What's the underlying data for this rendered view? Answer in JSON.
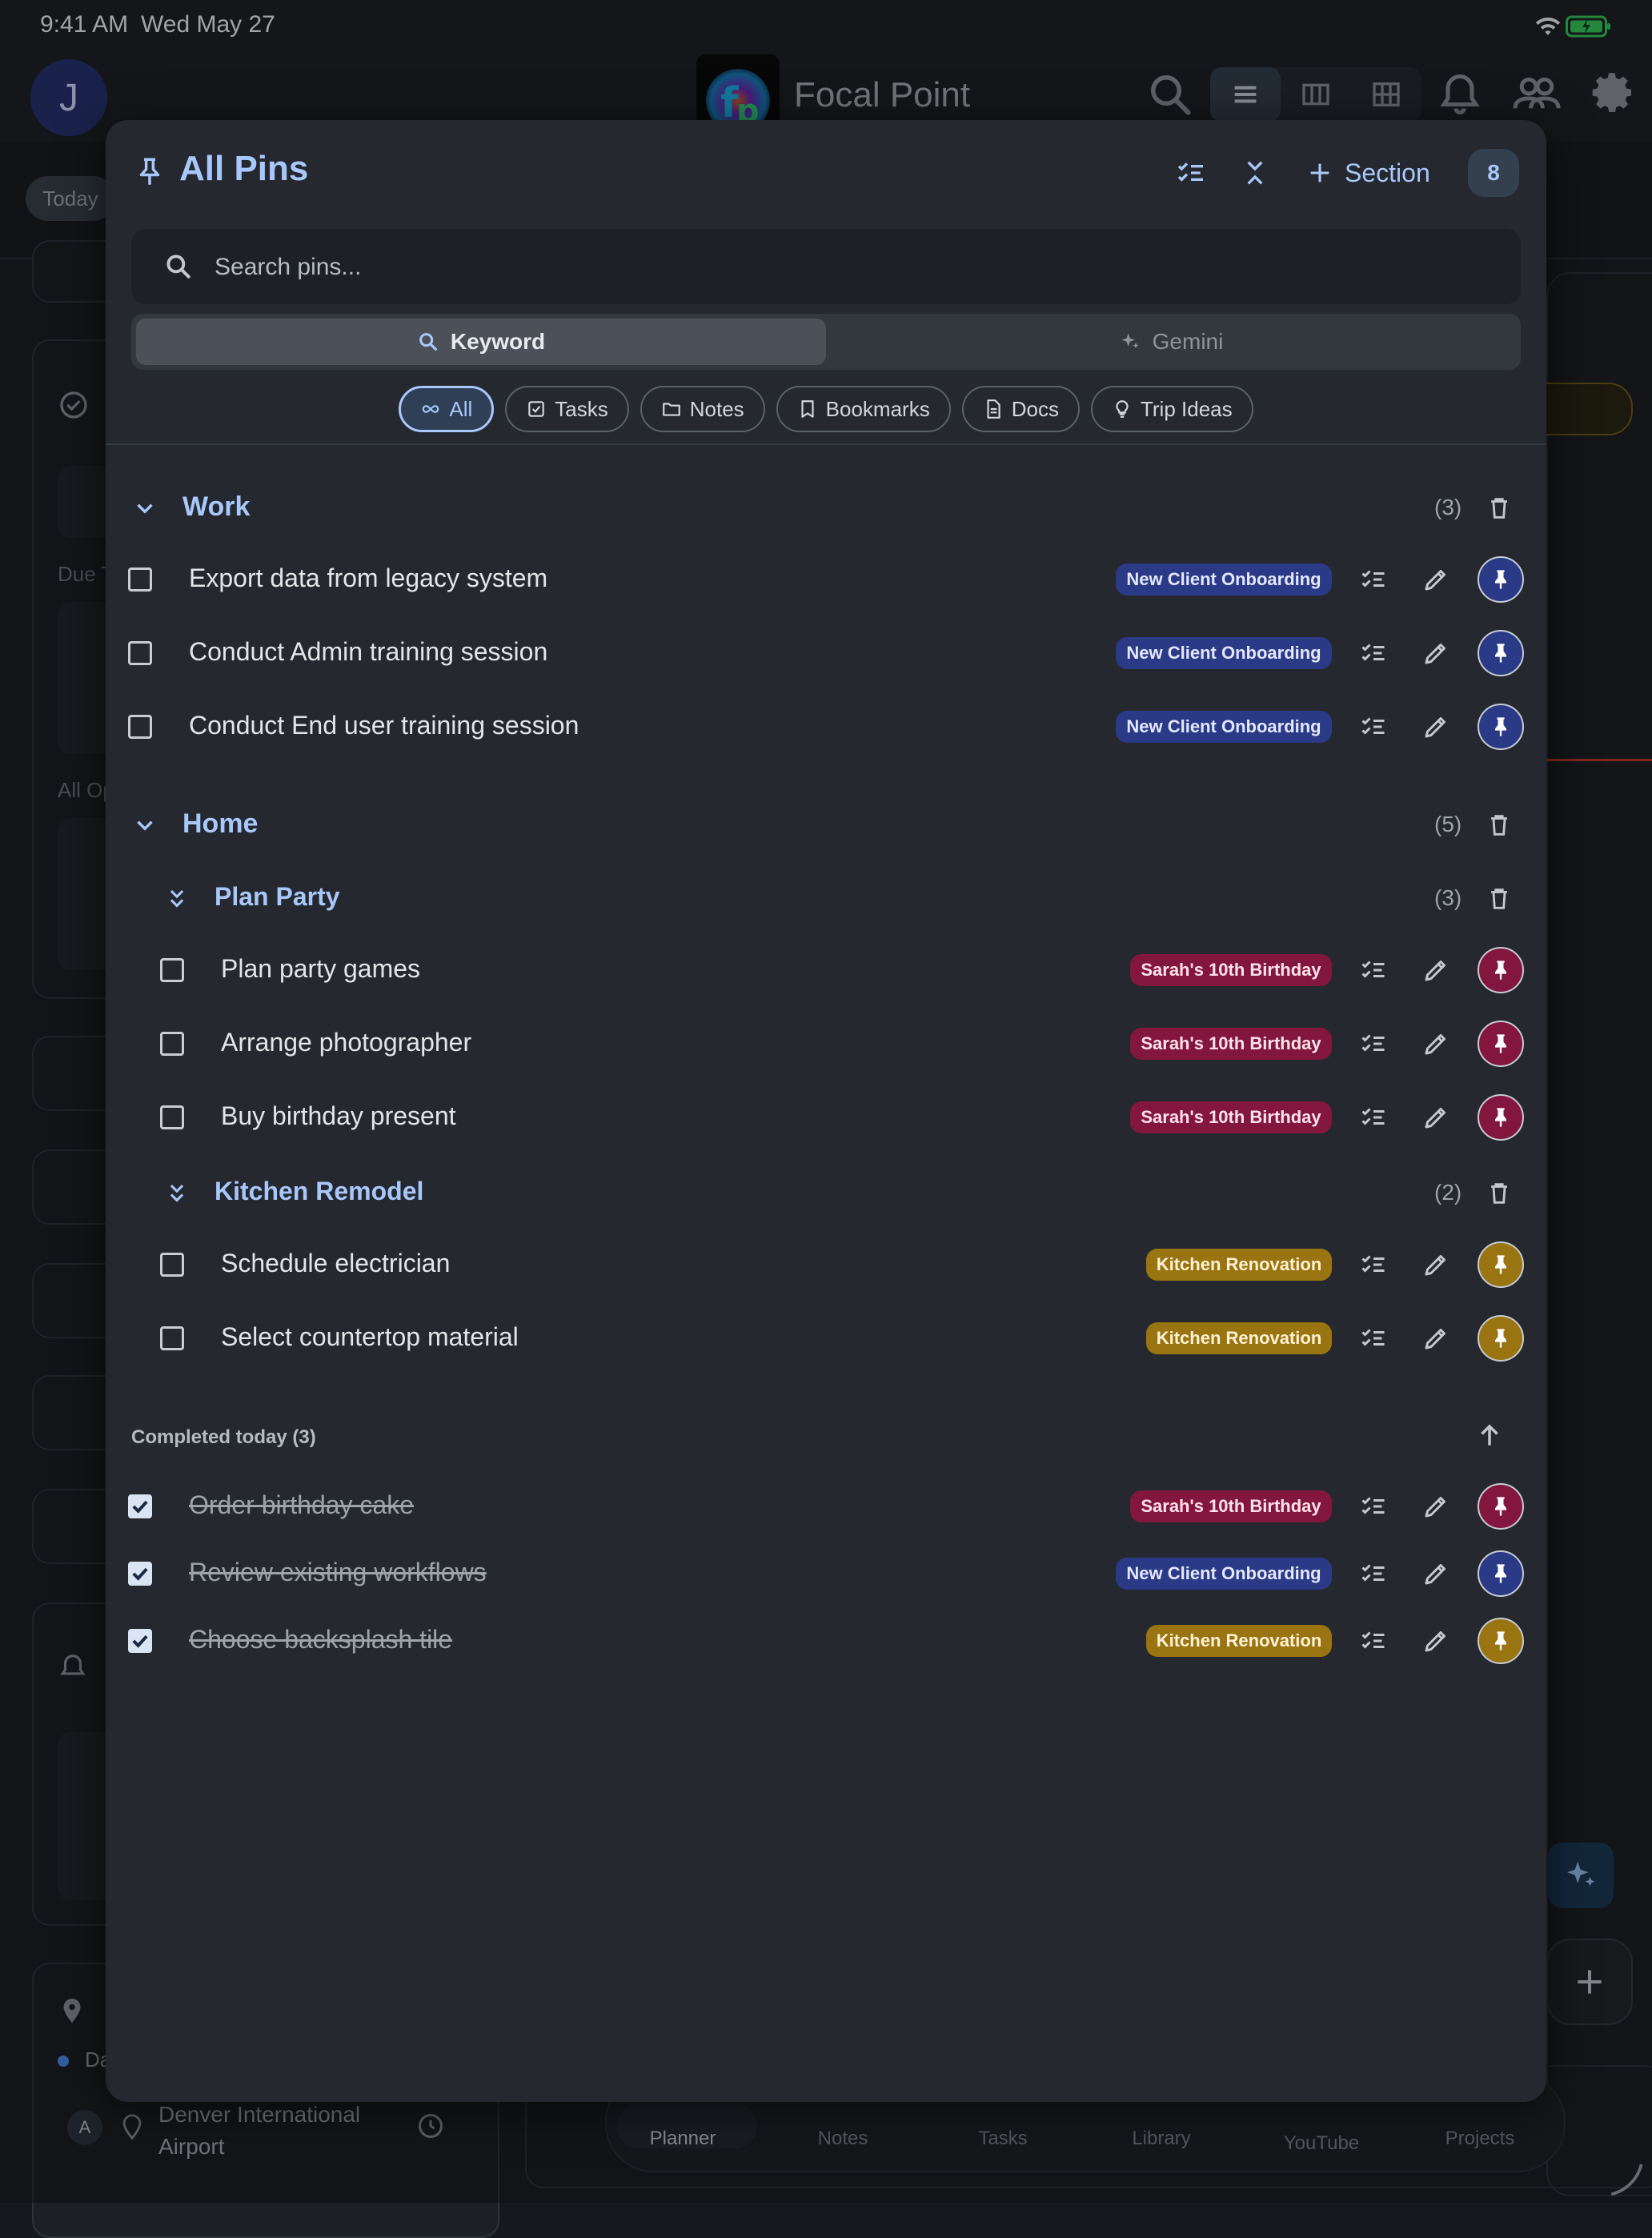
{
  "status_bar": {
    "time": "9:41 AM",
    "date": "Wed May 27"
  },
  "app_header": {
    "avatar_initial": "J",
    "app_title": "Focal Point",
    "today_chip": "Today",
    "icons": [
      "search-icon",
      "list-view-icon",
      "columns-view-icon",
      "grid-view-icon",
      "bell-icon",
      "people-icon",
      "gear-icon"
    ]
  },
  "background": {
    "due_label": "Due T",
    "all_label": "All Op",
    "location_short": "Da",
    "airport": "Denver International Airport",
    "airport_badge": "A",
    "bottom_nav": [
      "Planner",
      "Notes",
      "Tasks",
      "Library",
      "YouTube",
      "Projects"
    ]
  },
  "modal": {
    "title": "All Pins",
    "add_section_label": "Section",
    "pin_count": "8",
    "search_placeholder": "Search pins...",
    "search_modes": {
      "keyword": "Keyword",
      "gemini": "Gemini"
    },
    "filters": [
      "All",
      "Tasks",
      "Notes",
      "Bookmarks",
      "Docs",
      "Trip Ideas"
    ],
    "selected_filter": "All",
    "sections": {
      "work": {
        "title": "Work",
        "count": "(3)",
        "items": [
          {
            "text": "Export data from legacy system",
            "tag": "New Client Onboarding"
          },
          {
            "text": "Conduct Admin training session",
            "tag": "New Client Onboarding"
          },
          {
            "text": "Conduct End user training session",
            "tag": "New Client Onboarding"
          }
        ]
      },
      "home": {
        "title": "Home",
        "count": "(5)",
        "subsections": {
          "party": {
            "title": "Plan Party",
            "count": "(3)",
            "items": [
              {
                "text": "Plan party games",
                "tag": "Sarah's 10th Birthday"
              },
              {
                "text": "Arrange photographer",
                "tag": "Sarah's 10th Birthday"
              },
              {
                "text": "Buy birthday present",
                "tag": "Sarah's 10th Birthday"
              }
            ]
          },
          "kitchen": {
            "title": "Kitchen Remodel",
            "count": "(2)",
            "items": [
              {
                "text": "Schedule electrician",
                "tag": "Kitchen Renovation"
              },
              {
                "text": "Select countertop material",
                "tag": "Kitchen Renovation"
              }
            ]
          }
        }
      }
    },
    "completed": {
      "label": "Completed today (3)",
      "items": [
        {
          "text": "Order birthday cake",
          "tag": "Sarah's 10th Birthday"
        },
        {
          "text": "Review existing workflows",
          "tag": "New Client Onboarding"
        },
        {
          "text": "Choose backsplash tile",
          "tag": "Kitchen Renovation"
        }
      ]
    }
  },
  "colors": {
    "accent": "#a8c7fa",
    "work_tag": "#2a3a86",
    "party_tag": "#83163e",
    "kitchen_tag": "#9a7410",
    "modal_bg": "#25282e"
  }
}
